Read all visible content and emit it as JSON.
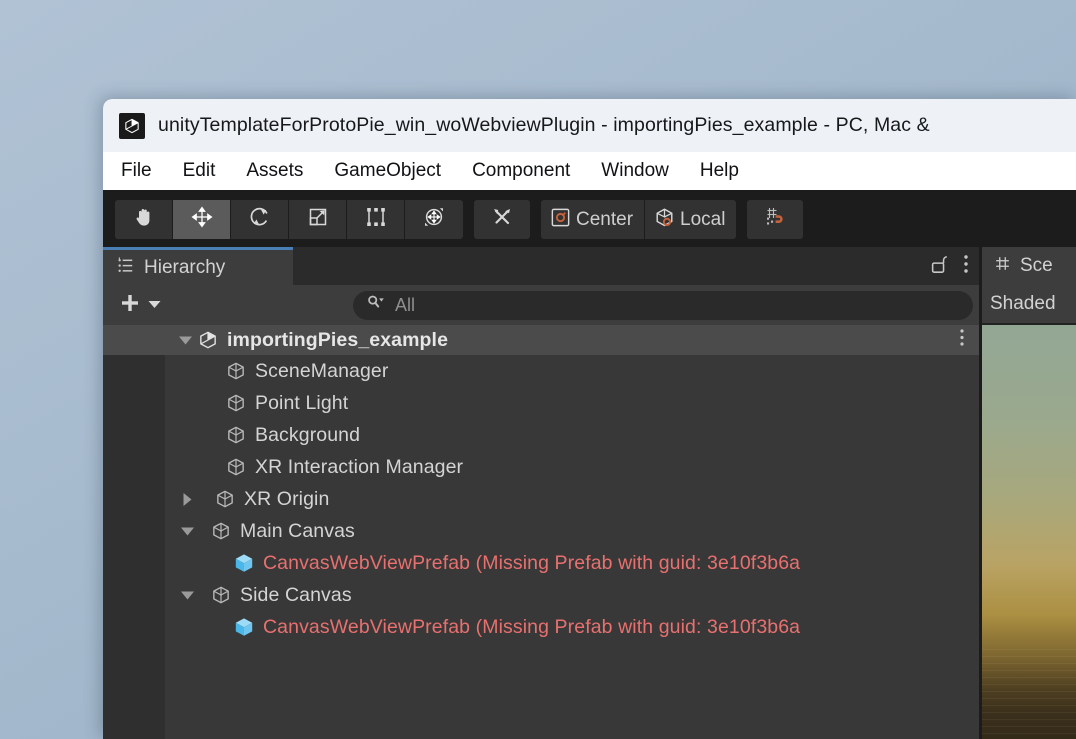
{
  "window": {
    "title": "unityTemplateForProtoPie_win_woWebviewPlugin - importingPies_example - PC, Mac &",
    "app_icon": "unity-logo-icon"
  },
  "menubar": {
    "items": [
      {
        "label": "File"
      },
      {
        "label": "Edit"
      },
      {
        "label": "Assets"
      },
      {
        "label": "GameObject"
      },
      {
        "label": "Component"
      },
      {
        "label": "Window"
      },
      {
        "label": "Help"
      }
    ]
  },
  "toolbar": {
    "transform_tools": [
      {
        "name": "hand-tool",
        "icon": "hand-icon",
        "active": false
      },
      {
        "name": "move-tool",
        "icon": "move-arrows-icon",
        "active": true
      },
      {
        "name": "rotate-tool",
        "icon": "rotate-icon",
        "active": false
      },
      {
        "name": "scale-tool",
        "icon": "scale-icon",
        "active": false
      },
      {
        "name": "rect-transform-tool",
        "icon": "rect-transform-icon",
        "active": false
      },
      {
        "name": "transform-tool",
        "icon": "transform-icon",
        "active": false
      }
    ],
    "custom_editor_tool": {
      "icon": "wrench-screwdriver-icon"
    },
    "pivot_mode": {
      "label": "Center",
      "icon": "pivot-center-icon"
    },
    "pivot_rotation": {
      "label": "Local",
      "icon": "pivot-local-icon"
    },
    "snap": {
      "icon": "grid-snap-magnet-icon"
    }
  },
  "hierarchy": {
    "tab_label": "Hierarchy",
    "tab_icon": "hierarchy-icon",
    "lock_icon": "padlock-open-icon",
    "menu_icon": "kebab-menu-icon",
    "add_label": "+",
    "add_icon": "plus-icon",
    "add_dropdown_icon": "chevron-down-icon",
    "search": {
      "placeholder": "All",
      "value": "",
      "icon": "search-dropdown-icon"
    },
    "tree": [
      {
        "label": "importingPies_example",
        "icon": "unity-scene-icon",
        "twisty": "expanded",
        "depth": 0,
        "style": "root",
        "kebab": "kebab-menu-icon"
      },
      {
        "label": "SceneManager",
        "icon": "gameobject-cube-icon",
        "twisty": "none",
        "depth": 1,
        "style": "normal"
      },
      {
        "label": "Point Light",
        "icon": "gameobject-cube-icon",
        "twisty": "none",
        "depth": 1,
        "style": "normal"
      },
      {
        "label": "Background",
        "icon": "gameobject-cube-icon",
        "twisty": "none",
        "depth": 1,
        "style": "normal"
      },
      {
        "label": "XR Interaction Manager",
        "icon": "gameobject-cube-icon",
        "twisty": "none",
        "depth": 1,
        "style": "normal"
      },
      {
        "label": "XR Origin",
        "icon": "gameobject-cube-icon",
        "twisty": "collapsed",
        "depth": 1,
        "style": "normal"
      },
      {
        "label": "Main Canvas",
        "icon": "gameobject-cube-icon",
        "twisty": "expanded",
        "depth": 1,
        "style": "normal"
      },
      {
        "label": "CanvasWebViewPrefab (Missing Prefab with guid: 3e10f3b6a",
        "icon": "prefab-cube-icon",
        "twisty": "none",
        "depth": 2,
        "style": "missing"
      },
      {
        "label": "Side Canvas",
        "icon": "gameobject-cube-icon",
        "twisty": "expanded",
        "depth": 1,
        "style": "normal"
      },
      {
        "label": "CanvasWebViewPrefab (Missing Prefab with guid: 3e10f3b6a",
        "icon": "prefab-cube-icon",
        "twisty": "none",
        "depth": 2,
        "style": "missing"
      }
    ]
  },
  "scene": {
    "tab_label": "Sce",
    "tab_icon": "scene-grid-icon",
    "shading_label": "Shaded"
  },
  "colors": {
    "accent_orange": "#c4613a",
    "tab_active_blue": "#4a7fb5",
    "missing_prefab_red": "#e8706f",
    "prefab_blue": "#6ec6f0",
    "panel_bg": "#383838",
    "toolbar_bg": "#1c1c1c",
    "titlebar_bg": "#eef2f7"
  }
}
